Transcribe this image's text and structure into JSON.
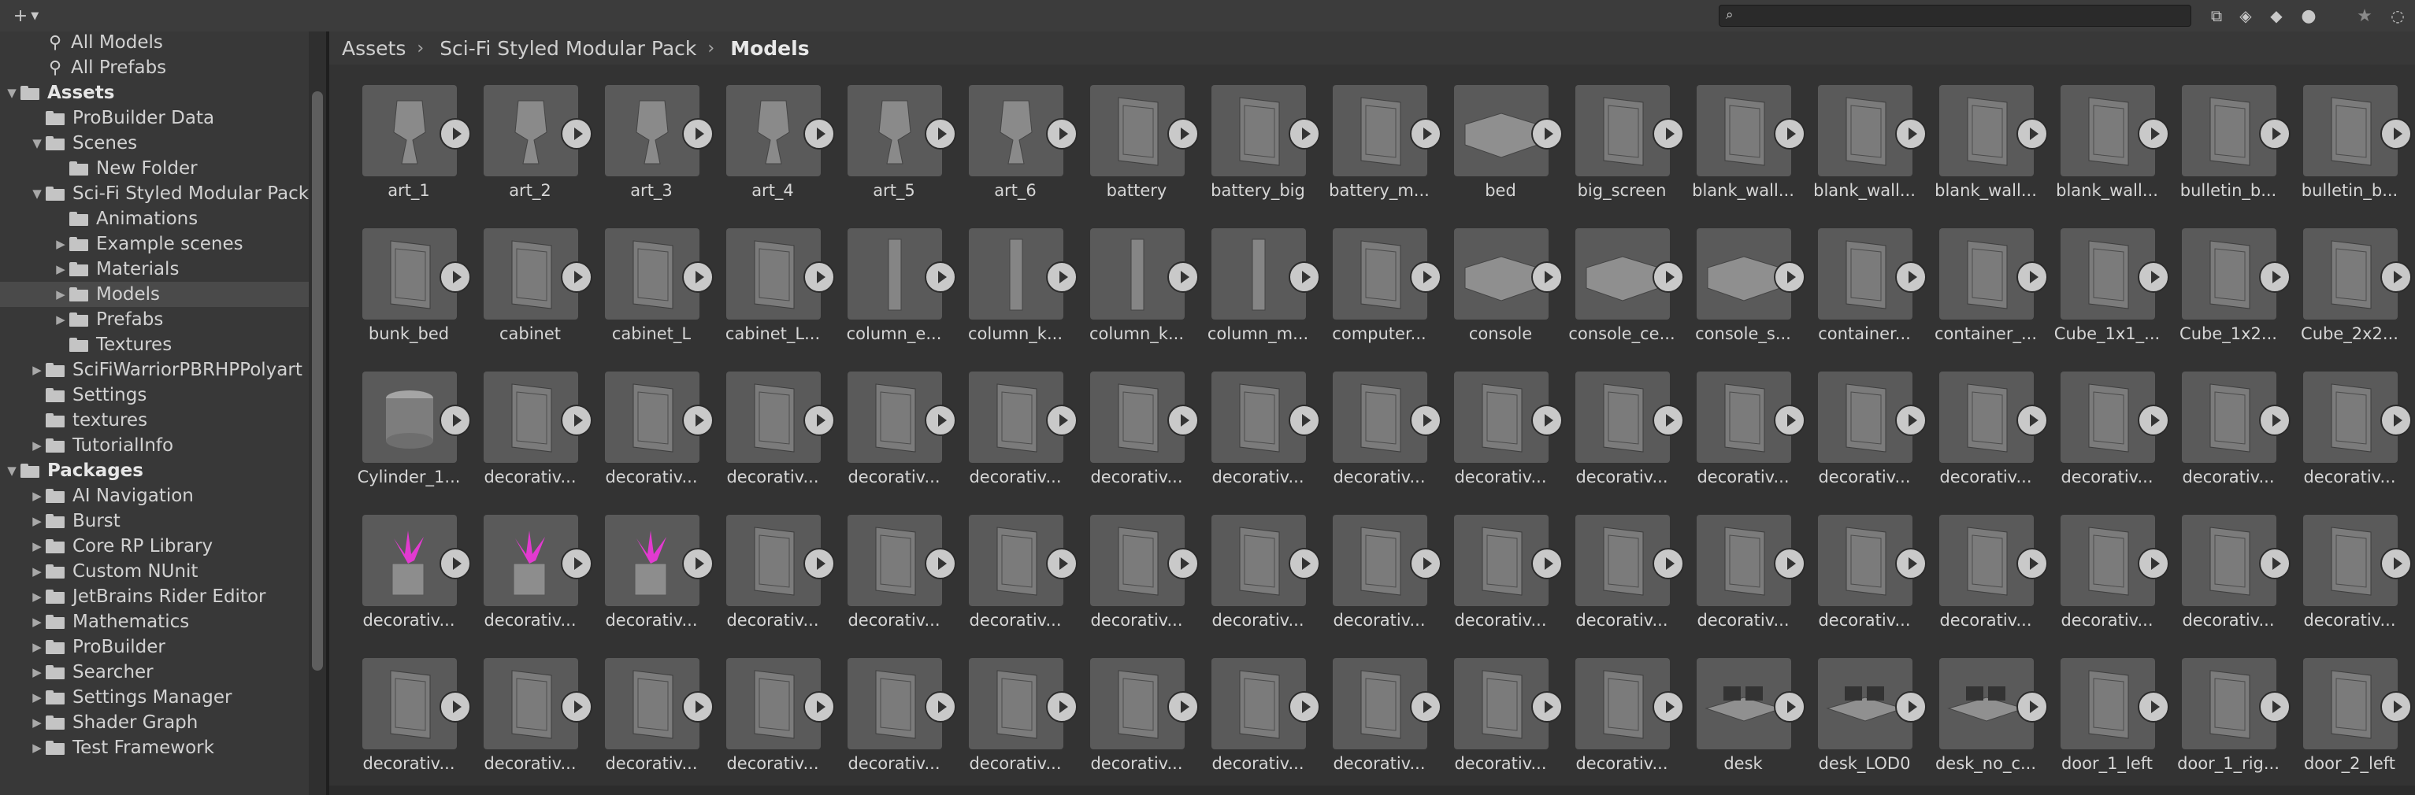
{
  "toolbar": {
    "add_icon": "plus-icon",
    "search": {
      "value": "",
      "placeholder": ""
    },
    "icons": [
      "scene-search-icon",
      "type-filter-icon",
      "label-filter-icon",
      "warning-icon",
      "favorite-star-icon",
      "hidden-toggle-icon"
    ]
  },
  "breadcrumb": [
    "Assets",
    "Sci-Fi Styled Modular Pack",
    "Models"
  ],
  "tree": [
    {
      "label": "All Models",
      "icon": "search",
      "indent": 1,
      "arrow": ""
    },
    {
      "label": "All Prefabs",
      "icon": "search",
      "indent": 1,
      "arrow": ""
    },
    {
      "label": "Assets",
      "icon": "folder",
      "indent": 0,
      "arrow": "open",
      "bold": true
    },
    {
      "label": "ProBuilder Data",
      "icon": "folder",
      "indent": 1,
      "arrow": ""
    },
    {
      "label": "Scenes",
      "icon": "folder",
      "indent": 1,
      "arrow": "open"
    },
    {
      "label": "New Folder",
      "icon": "folder",
      "indent": 2,
      "arrow": ""
    },
    {
      "label": "Sci-Fi Styled Modular Pack",
      "icon": "folder",
      "indent": 1,
      "arrow": "open"
    },
    {
      "label": "Animations",
      "icon": "folder",
      "indent": 2,
      "arrow": ""
    },
    {
      "label": "Example scenes",
      "icon": "folder",
      "indent": 2,
      "arrow": "closed"
    },
    {
      "label": "Materials",
      "icon": "folder",
      "indent": 2,
      "arrow": "closed"
    },
    {
      "label": "Models",
      "icon": "folder",
      "indent": 2,
      "arrow": "closed",
      "selected": true
    },
    {
      "label": "Prefabs",
      "icon": "folder",
      "indent": 2,
      "arrow": "closed"
    },
    {
      "label": "Textures",
      "icon": "folder",
      "indent": 2,
      "arrow": ""
    },
    {
      "label": "SciFiWarriorPBRHPPolyart",
      "icon": "folder",
      "indent": 1,
      "arrow": "closed"
    },
    {
      "label": "Settings",
      "icon": "folder",
      "indent": 1,
      "arrow": ""
    },
    {
      "label": "textures",
      "icon": "folder",
      "indent": 1,
      "arrow": ""
    },
    {
      "label": "TutorialInfo",
      "icon": "folder",
      "indent": 1,
      "arrow": "closed"
    },
    {
      "label": "Packages",
      "icon": "folder",
      "indent": 0,
      "arrow": "open",
      "bold": true
    },
    {
      "label": "AI Navigation",
      "icon": "folder",
      "indent": 1,
      "arrow": "closed"
    },
    {
      "label": "Burst",
      "icon": "folder",
      "indent": 1,
      "arrow": "closed"
    },
    {
      "label": "Core RP Library",
      "icon": "folder",
      "indent": 1,
      "arrow": "closed"
    },
    {
      "label": "Custom NUnit",
      "icon": "folder",
      "indent": 1,
      "arrow": "closed"
    },
    {
      "label": "JetBrains Rider Editor",
      "icon": "folder",
      "indent": 1,
      "arrow": "closed"
    },
    {
      "label": "Mathematics",
      "icon": "folder",
      "indent": 1,
      "arrow": "closed"
    },
    {
      "label": "ProBuilder",
      "icon": "folder",
      "indent": 1,
      "arrow": "closed"
    },
    {
      "label": "Searcher",
      "icon": "folder",
      "indent": 1,
      "arrow": "closed"
    },
    {
      "label": "Settings Manager",
      "icon": "folder",
      "indent": 1,
      "arrow": "closed"
    },
    {
      "label": "Shader Graph",
      "icon": "folder",
      "indent": 1,
      "arrow": "closed"
    },
    {
      "label": "Test Framework",
      "icon": "folder",
      "indent": 1,
      "arrow": "closed"
    }
  ],
  "assets": [
    [
      "art_1",
      "art_2",
      "art_3",
      "art_4",
      "art_5",
      "art_6",
      "battery",
      "battery_big",
      "battery_m...",
      "bed",
      "big_screen",
      "blank_wall...",
      "blank_wall...",
      "blank_wall...",
      "blank_wall...",
      "bulletin_b...",
      "bulletin_b..."
    ],
    [
      "bunk_bed",
      "cabinet",
      "cabinet_L",
      "cabinet_L...",
      "column_e...",
      "column_k...",
      "column_k...",
      "column_m...",
      "computer...",
      "console",
      "console_ce...",
      "console_s...",
      "container...",
      "container_...",
      "Cube_1x1_...",
      "Cube_1x2...",
      "Cube_2x2..."
    ],
    [
      "Cylinder_1...",
      "decorativ...",
      "decorativ...",
      "decorativ...",
      "decorativ...",
      "decorativ...",
      "decorativ...",
      "decorativ...",
      "decorativ...",
      "decorativ...",
      "decorativ...",
      "decorativ...",
      "decorativ...",
      "decorativ...",
      "decorativ...",
      "decorativ...",
      "decorativ..."
    ],
    [
      "decorativ...",
      "decorativ...",
      "decorativ...",
      "decorativ...",
      "decorativ...",
      "decorativ...",
      "decorativ...",
      "decorativ...",
      "decorativ...",
      "decorativ...",
      "decorativ...",
      "decorativ...",
      "decorativ...",
      "decorativ...",
      "decorativ...",
      "decorativ...",
      "decorativ..."
    ],
    [
      "decorativ...",
      "decorativ...",
      "decorativ...",
      "decorativ...",
      "decorativ...",
      "decorativ...",
      "decorativ...",
      "decorativ...",
      "decorativ...",
      "decorativ...",
      "decorativ...",
      "desk",
      "desk_LOD0",
      "desk_no_c...",
      "door_1_left",
      "door_1_rig...",
      "door_2_left"
    ]
  ],
  "colors": {
    "plant_accent": "#e23ad0"
  }
}
